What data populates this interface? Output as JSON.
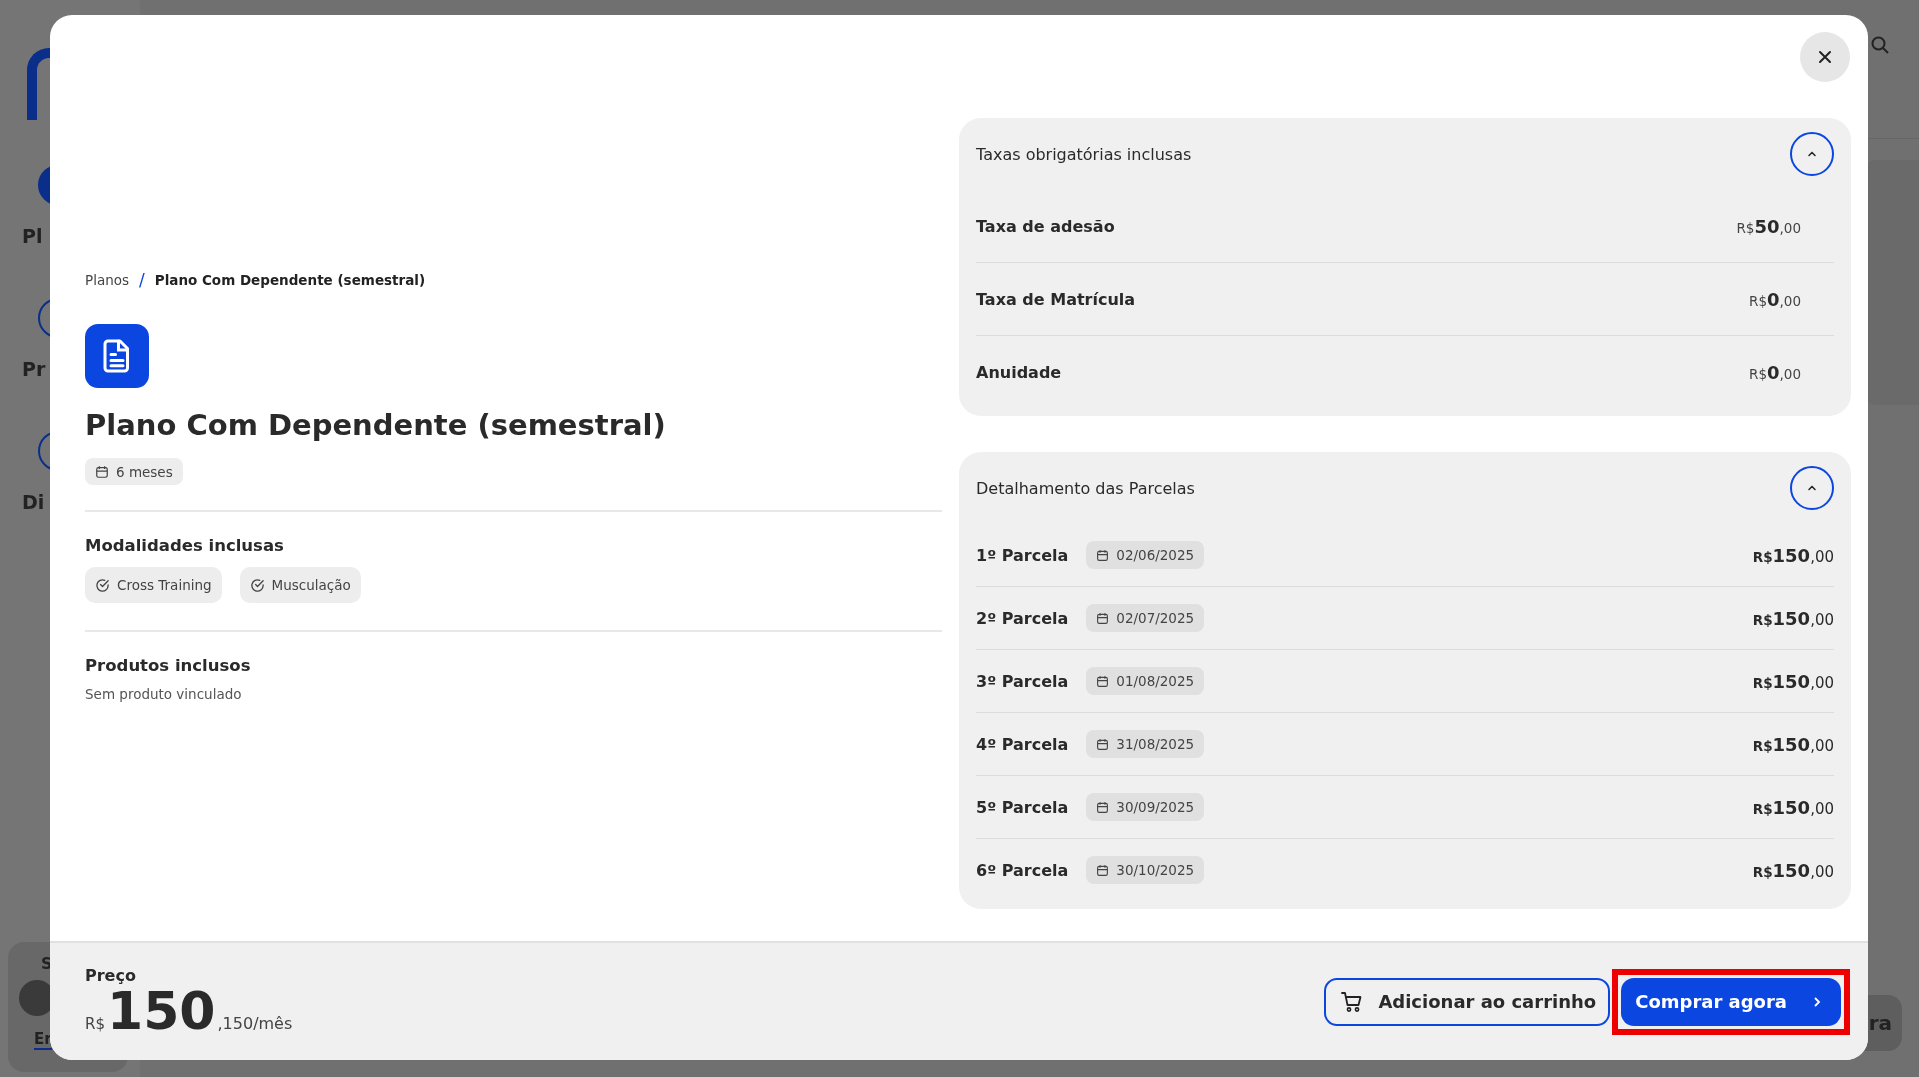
{
  "background": {
    "nav_labels": [
      "Pl",
      "Pr",
      "Di"
    ],
    "card_label": "S",
    "card_link": "Er",
    "button_label": "ra"
  },
  "breadcrumb_separator": "/",
  "breadcrumb": [
    {
      "label": "Planos",
      "current": false
    },
    {
      "label": "Plano Com Dependente (semestral)",
      "current": true
    }
  ],
  "plan": {
    "title": "Plano Com Dependente (semestral)",
    "duration": "6 meses"
  },
  "modalities": {
    "title": "Modalidades inclusas",
    "items": [
      "Cross Training",
      "Musculação"
    ]
  },
  "products": {
    "title": "Produtos inclusos",
    "empty_text": "Sem produto vinculado"
  },
  "fees": {
    "title": "Taxas obrigatórias inclusas",
    "expanded": true,
    "rows": [
      {
        "label": "Taxa de adesão",
        "currency": "R$",
        "whole": "50",
        "cents": ",00"
      },
      {
        "label": "Taxa de Matrícula",
        "currency": "R$",
        "whole": "0",
        "cents": ",00"
      },
      {
        "label": "Anuidade",
        "currency": "R$",
        "whole": "0",
        "cents": ",00"
      }
    ]
  },
  "installments": {
    "title": "Detalhamento das Parcelas",
    "expanded": true,
    "rows": [
      {
        "label": "1º Parcela",
        "date": "02/06/2025",
        "currency": "R$",
        "whole": "150",
        "cents": ",00"
      },
      {
        "label": "2º Parcela",
        "date": "02/07/2025",
        "currency": "R$",
        "whole": "150",
        "cents": ",00"
      },
      {
        "label": "3º Parcela",
        "date": "01/08/2025",
        "currency": "R$",
        "whole": "150",
        "cents": ",00"
      },
      {
        "label": "4º Parcela",
        "date": "31/08/2025",
        "currency": "R$",
        "whole": "150",
        "cents": ",00"
      },
      {
        "label": "5º Parcela",
        "date": "30/09/2025",
        "currency": "R$",
        "whole": "150",
        "cents": ",00"
      },
      {
        "label": "6º Parcela",
        "date": "30/10/2025",
        "currency": "R$",
        "whole": "150",
        "cents": ",00"
      }
    ]
  },
  "footer": {
    "price_label": "Preço",
    "currency": "R$",
    "amount": "150",
    "suffix": ",150/mês",
    "cart_button": "Adicionar ao carrinho",
    "buy_button": "Comprar agora",
    "buy_highlighted": true
  }
}
